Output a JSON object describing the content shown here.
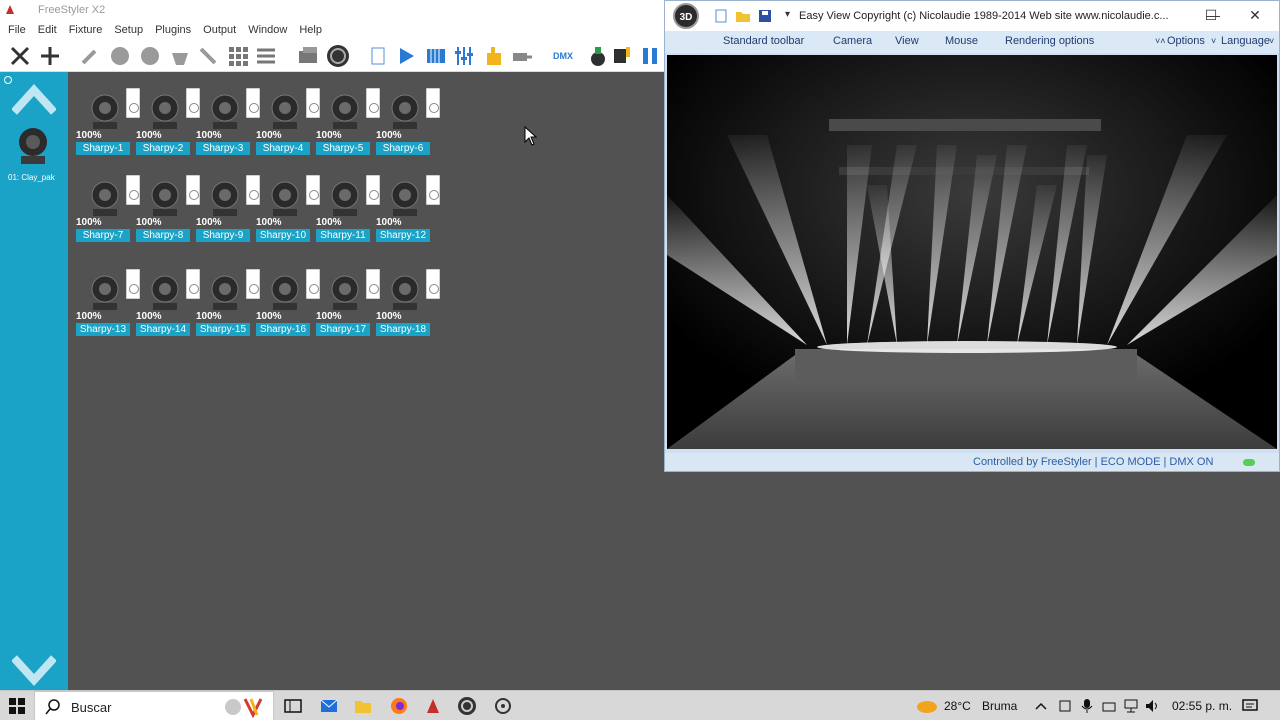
{
  "app": {
    "title": "FreeStyler X2"
  },
  "menu": [
    "File",
    "Edit",
    "Fixture",
    "Setup",
    "Plugins",
    "Output",
    "Window",
    "Help"
  ],
  "toolbar_icons": [
    "cross-arrows-icon",
    "wrench-icon",
    "circle-icon",
    "circle-icon",
    "moving-head-icon",
    "wand-icon",
    "grid-icon",
    "list-icon",
    "stack-icon",
    "3d-icon",
    "page-icon",
    "play-icon",
    "sequence-icon",
    "faders-icon",
    "hand-icon",
    "fog-icon",
    "dmx-icon",
    "bottle-icon",
    "speaker-icon",
    "pause-icon"
  ],
  "sidebar": {
    "fixture_label": "01: Clay_pak"
  },
  "fixtures": [
    {
      "level": "100%",
      "label": "Sharpy-1"
    },
    {
      "level": "100%",
      "label": "Sharpy-2"
    },
    {
      "level": "100%",
      "label": "Sharpy-3"
    },
    {
      "level": "100%",
      "label": "Sharpy-4"
    },
    {
      "level": "100%",
      "label": "Sharpy-5"
    },
    {
      "level": "100%",
      "label": "Sharpy-6"
    },
    {
      "level": "100%",
      "label": "Sharpy-7"
    },
    {
      "level": "100%",
      "label": "Sharpy-8"
    },
    {
      "level": "100%",
      "label": "Sharpy-9"
    },
    {
      "level": "100%",
      "label": "Sharpy-10"
    },
    {
      "level": "100%",
      "label": "Sharpy-11"
    },
    {
      "level": "100%",
      "label": "Sharpy-12"
    },
    {
      "level": "100%",
      "label": "Sharpy-13"
    },
    {
      "level": "100%",
      "label": "Sharpy-14"
    },
    {
      "level": "100%",
      "label": "Sharpy-15"
    },
    {
      "level": "100%",
      "label": "Sharpy-16"
    },
    {
      "level": "100%",
      "label": "Sharpy-17"
    },
    {
      "level": "100%",
      "label": "Sharpy-18"
    }
  ],
  "easy_view": {
    "logo": "3D",
    "title": "Easy View  Copyright (c) Nicolaudie 1989-2014   Web site www.nicolaudie.c...",
    "menu": [
      "Standard toolbar",
      "Camera",
      "View",
      "Mouse",
      "Rendering options"
    ],
    "options": "Options",
    "language": "Language",
    "status": "Controlled by FreeStyler  |  ECO MODE  |  DMX ON"
  },
  "taskbar": {
    "search_placeholder": "Buscar",
    "weather_temp": "28°C",
    "weather_desc": "Bruma",
    "time": "02:55 p. m."
  },
  "colors": {
    "accent": "#1aa3c7",
    "workspace": "#525252"
  }
}
